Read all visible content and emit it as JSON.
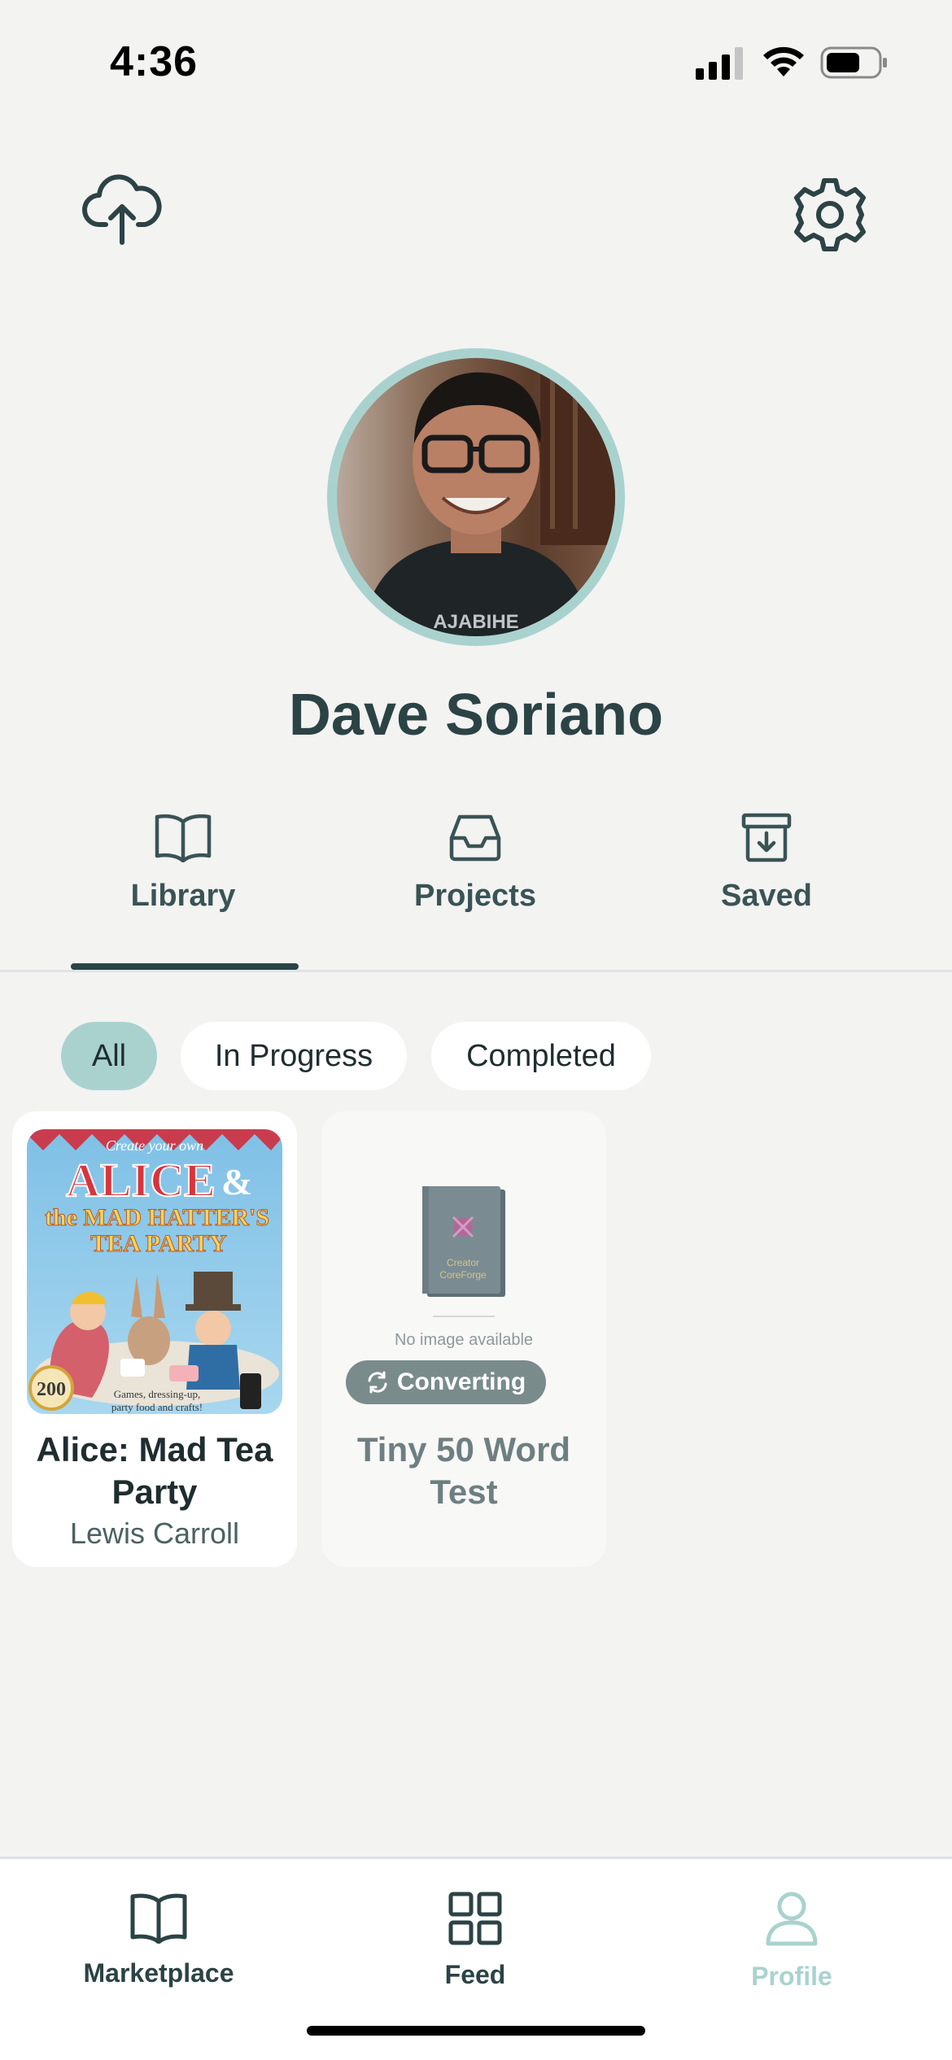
{
  "status_bar": {
    "time": "4:36"
  },
  "profile": {
    "name": "Dave Soriano"
  },
  "tabs": [
    {
      "label": "Library",
      "icon": "open-book-icon",
      "active": true
    },
    {
      "label": "Projects",
      "icon": "inbox-tray-icon",
      "active": false
    },
    {
      "label": "Saved",
      "icon": "archive-download-icon",
      "active": false
    }
  ],
  "filters": [
    {
      "label": "All",
      "selected": true
    },
    {
      "label": "In Progress",
      "selected": false
    },
    {
      "label": "Completed",
      "selected": false
    }
  ],
  "books": [
    {
      "title": "Alice: Mad Tea Party",
      "author": "Lewis Carroll",
      "cover_text": {
        "top": "Create your own",
        "main": "ALICE",
        "amp": "&",
        "sub1": "the MAD HATTER'S",
        "sub2": "TEA PARTY",
        "badge": "200",
        "caption": "Games, dressing-up, party food and crafts!"
      }
    },
    {
      "title": "Tiny 50 Word Test",
      "placeholder_text": "No  image available",
      "placeholder_book_text": "Creator CoreForge",
      "status": "Converting"
    }
  ],
  "bottom_nav": [
    {
      "label": "Marketplace",
      "icon": "open-book-icon",
      "active": false
    },
    {
      "label": "Feed",
      "icon": "grid-icon",
      "active": false
    },
    {
      "label": "Profile",
      "icon": "person-icon",
      "active": true
    }
  ],
  "colors": {
    "background": "#f3f3f2",
    "accent": "#a9d2cf",
    "text_dark": "#2c4345",
    "badge_gray": "#7a8b8c"
  }
}
